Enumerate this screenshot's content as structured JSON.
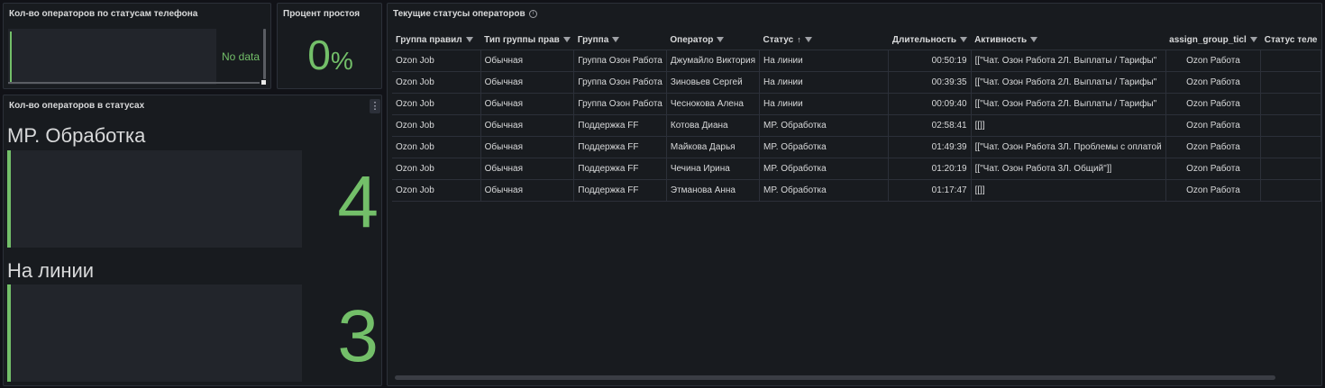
{
  "panel_phone": {
    "title": "Кол-во операторов по статусам телефона",
    "no_data": "No data"
  },
  "panel_idle": {
    "title": "Процент простоя",
    "value": "0",
    "unit": "%"
  },
  "panel_statuses": {
    "title": "Кол-во операторов в статусах",
    "stats": [
      {
        "label": "MP. Обработка",
        "value": "4"
      },
      {
        "label": "На линии",
        "value": "3"
      }
    ]
  },
  "panel_table": {
    "title": "Текущие статусы операторов",
    "columns": [
      "Группа правил",
      "Тип группы прав",
      "Группа",
      "Оператор",
      "Статус",
      "Длительность",
      "Активность",
      "assign_group_ticl",
      "Статус теле"
    ],
    "rows": [
      [
        "Ozon Job",
        "Обычная",
        "Группа Озон Работа",
        "Джумайло Виктория",
        "На линии",
        "00:50:19",
        "[[\"Чат. Озон Работа 2Л. Выплаты / Тарифы\"",
        "Ozon Работа",
        ""
      ],
      [
        "Ozon Job",
        "Обычная",
        "Группа Озон Работа",
        "Зиновьев Сергей",
        "На линии",
        "00:39:35",
        "[[\"Чат. Озон Работа 2Л. Выплаты / Тарифы\"",
        "Ozon Работа",
        ""
      ],
      [
        "Ozon Job",
        "Обычная",
        "Группа Озон Работа",
        "Чеснокова Алена",
        "На линии",
        "00:09:40",
        "[[\"Чат. Озон Работа 2Л. Выплаты / Тарифы\"",
        "Ozon Работа",
        ""
      ],
      [
        "Ozon Job",
        "Обычная",
        "Поддержка FF",
        "Котова Диана",
        "MP. Обработка",
        "02:58:41",
        "[[]]",
        "Ozon Работа",
        ""
      ],
      [
        "Ozon Job",
        "Обычная",
        "Поддержка FF",
        "Майкова Дарья",
        "MP. Обработка",
        "01:49:39",
        "[[\"Чат. Озон Работа 3Л. Проблемы с оплатой",
        "Ozon Работа",
        ""
      ],
      [
        "Ozon Job",
        "Обычная",
        "Поддержка FF",
        "Чечина Ирина",
        "MP. Обработка",
        "01:20:19",
        "[[\"Чат. Озон Работа 3Л. Общий\"]]",
        "Ozon Работа",
        ""
      ],
      [
        "Ozon Job",
        "Обычная",
        "Поддержка FF",
        "Этманова Анна",
        "MP. Обработка",
        "01:17:47",
        "[[]]",
        "Ozon Работа",
        ""
      ]
    ]
  },
  "colors": {
    "accent": "#73bf69",
    "background": "#111217",
    "panel": "#181b1f"
  }
}
